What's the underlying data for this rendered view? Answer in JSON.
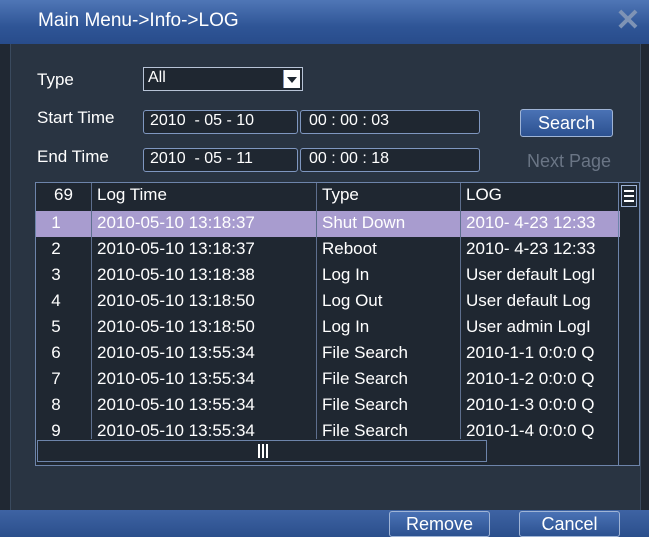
{
  "window": {
    "title": "Main Menu->Info->LOG",
    "close_icon": "close-icon"
  },
  "filters": {
    "type_label": "Type",
    "type_value": "All",
    "start_label": "Start Time",
    "start_date": "2010  - 05 - 10",
    "start_time": "00 : 00 : 03",
    "end_label": "End Time",
    "end_date": "2010  - 05 - 11",
    "end_time": "00 : 00 : 18"
  },
  "buttons": {
    "search": "Search",
    "next_page": "Next Page",
    "remove": "Remove",
    "cancel": "Cancel"
  },
  "table": {
    "count": "69",
    "headers": {
      "time": "Log Time",
      "type": "Type",
      "log": "LOG"
    },
    "rows": [
      {
        "n": "1",
        "time": "2010-05-10 13:18:37",
        "type": "Shut Down",
        "log": "2010- 4-23 12:33"
      },
      {
        "n": "2",
        "time": "2010-05-10 13:18:37",
        "type": "Reboot",
        "log": "2010- 4-23 12:33"
      },
      {
        "n": "3",
        "time": "2010-05-10 13:18:38",
        "type": "Log In",
        "log": "User default LogI"
      },
      {
        "n": "4",
        "time": "2010-05-10 13:18:50",
        "type": "Log Out",
        "log": "User default Log"
      },
      {
        "n": "5",
        "time": "2010-05-10 13:18:50",
        "type": "Log In",
        "log": "User admin LogI"
      },
      {
        "n": "6",
        "time": "2010-05-10 13:55:34",
        "type": "File Search",
        "log": "2010-1-1 0:0:0 Q"
      },
      {
        "n": "7",
        "time": "2010-05-10 13:55:34",
        "type": "File Search",
        "log": "2010-1-2 0:0:0 Q"
      },
      {
        "n": "8",
        "time": "2010-05-10 13:55:34",
        "type": "File Search",
        "log": "2010-1-3 0:0:0 Q"
      },
      {
        "n": "9",
        "time": "2010-05-10 13:55:34",
        "type": "File Search",
        "log": "2010-1-4 0:0:0 Q"
      }
    ],
    "selected_row": "1"
  },
  "colors": {
    "title_bar": "#2f5596",
    "selection": "#a89ccf",
    "background": "#293442"
  }
}
